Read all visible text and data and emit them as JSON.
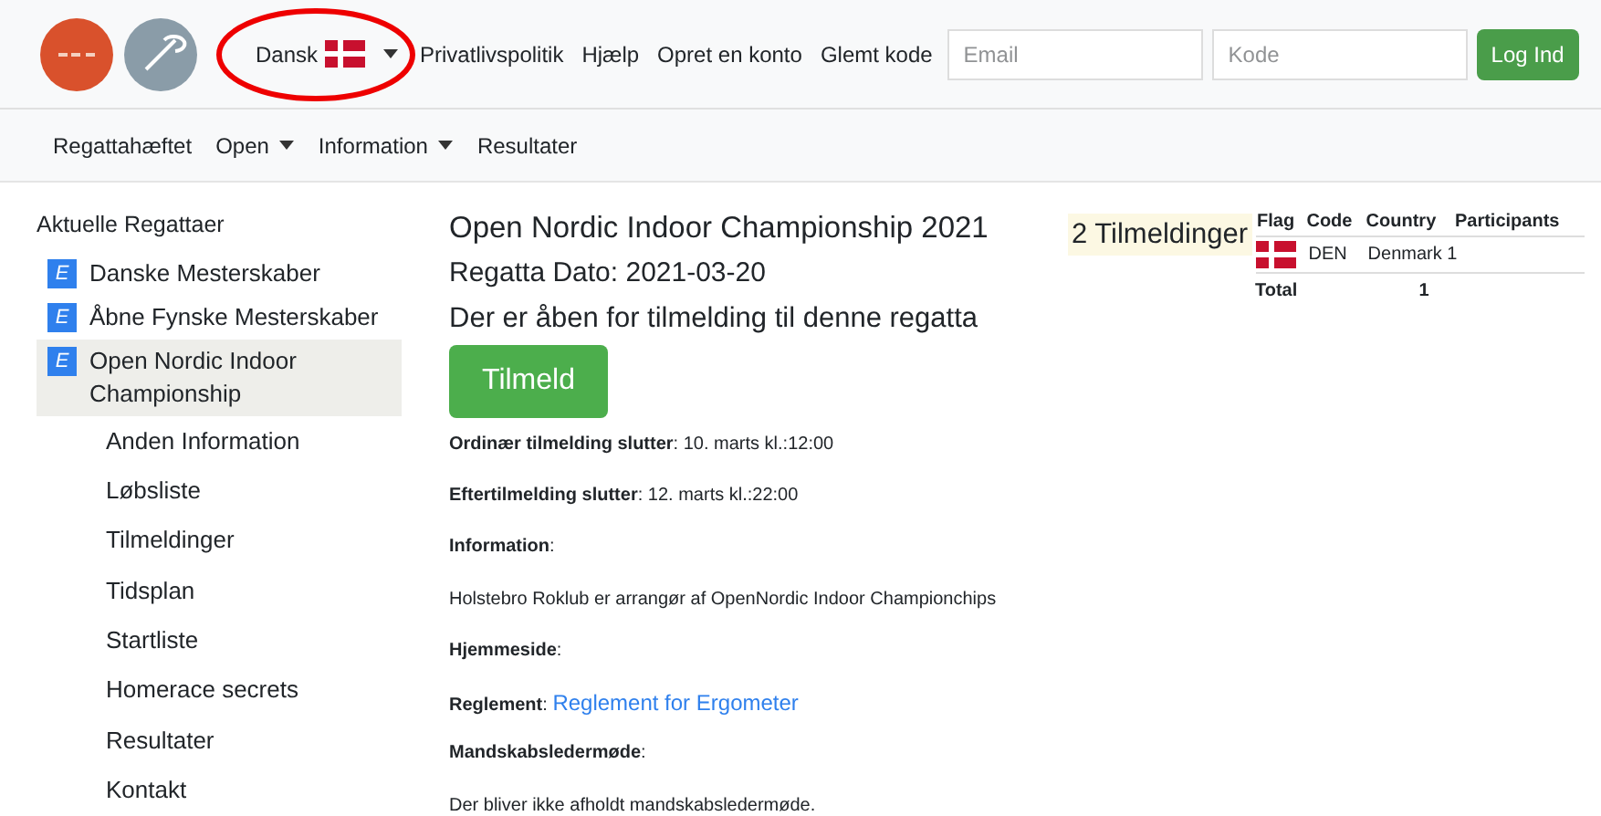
{
  "header": {
    "language": "Dansk",
    "links": [
      "Privatlivspolitik",
      "Hjælp",
      "Opret en konto",
      "Glemt kode"
    ],
    "email": {
      "placeholder": "Email"
    },
    "password": {
      "placeholder": "Kode"
    },
    "login_button": "Log Ind"
  },
  "nav": [
    {
      "label": "Regattahæftet",
      "dropdown": false
    },
    {
      "label": "Open",
      "dropdown": true
    },
    {
      "label": "Information",
      "dropdown": true
    },
    {
      "label": "Resultater",
      "dropdown": false
    }
  ],
  "sidebar": {
    "title": "Aktuelle Regattaer",
    "items": [
      {
        "badge": "E",
        "label": "Danske Mesterskaber",
        "selected": false
      },
      {
        "badge": "E",
        "label": "Åbne Fynske Mesterskaber",
        "selected": false
      },
      {
        "badge": "E",
        "label": "Open Nordic Indoor Championship",
        "selected": true,
        "children": [
          {
            "label": "Anden Information"
          },
          {
            "label": "Løbsliste"
          },
          {
            "label": "Tilmeldinger"
          },
          {
            "label": "Tidsplan"
          },
          {
            "label": "Startliste"
          },
          {
            "label": "Homerace secrets"
          },
          {
            "label": "Resultater"
          },
          {
            "label": "Kontakt"
          }
        ]
      }
    ]
  },
  "main": {
    "title": "Open Nordic Indoor Championship 2021",
    "date": "Regatta Dato: 2021-03-20",
    "open_notice": "Der er åben for tilmelding til denne regatta",
    "register_button": "Tilmeld",
    "fields": [
      {
        "kind": "line",
        "text": "**Ordinær tilmelding slutter**: 10. marts kl.:12:00"
      },
      {
        "kind": "line",
        "text": "**Eftertilmelding slutter**: 12. marts kl.:22:00"
      },
      {
        "kind": "line",
        "text": "**Information**:"
      },
      {
        "kind": "line",
        "text": "Holstebro Roklub er arrangør af OpenNordic Indoor Championchips"
      },
      {
        "kind": "line",
        "text": "**Hjemmeside**:"
      },
      {
        "kind": "link",
        "text": "**Reglement**: ",
        "link": "Reglement for Ergometer"
      },
      {
        "kind": "line",
        "text": "**Mandskabsledermøde**:"
      },
      {
        "kind": "line",
        "text": "Der bliver ikke afholdt mandskabsledermøde."
      }
    ]
  },
  "registrations": {
    "count_label": "2 Tilmeldinger",
    "table": {
      "columns": [
        "Flag",
        "Code",
        "Country",
        "Participants"
      ],
      "rows": [
        {
          "code": "DEN",
          "country": "Denmark",
          "participants": "1"
        }
      ],
      "total_label": "Total",
      "total": "1"
    }
  }
}
